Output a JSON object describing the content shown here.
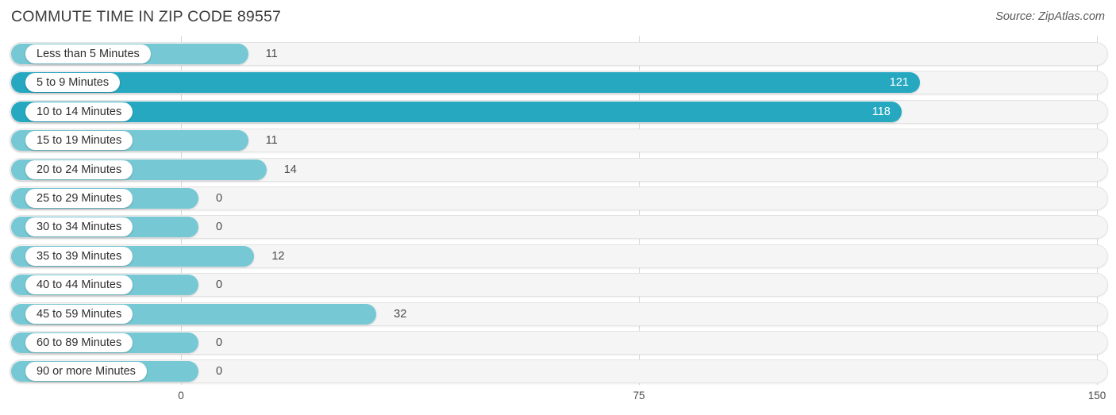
{
  "header": {
    "title": "COMMUTE TIME IN ZIP CODE 89557",
    "source": "Source: ZipAtlas.com"
  },
  "chart_data": {
    "type": "bar",
    "orientation": "horizontal",
    "title": "COMMUTE TIME IN ZIP CODE 89557",
    "xlabel": "",
    "ylabel": "",
    "xlim": [
      0,
      150
    ],
    "ticks": [
      "0",
      "75",
      "150"
    ],
    "tick_values": [
      0,
      75,
      150
    ],
    "grid": true,
    "legend": null,
    "categories": [
      "Less than 5 Minutes",
      "5 to 9 Minutes",
      "10 to 14 Minutes",
      "15 to 19 Minutes",
      "20 to 24 Minutes",
      "25 to 29 Minutes",
      "30 to 34 Minutes",
      "35 to 39 Minutes",
      "40 to 44 Minutes",
      "45 to 59 Minutes",
      "60 to 89 Minutes",
      "90 or more Minutes"
    ],
    "values": [
      11,
      121,
      118,
      11,
      14,
      0,
      0,
      12,
      0,
      32,
      0,
      0
    ],
    "value_labels": [
      "11",
      "121",
      "118",
      "11",
      "14",
      "0",
      "0",
      "12",
      "0",
      "32",
      "0",
      "0"
    ],
    "colors": {
      "bar_light": "#76c8d4",
      "bar_dark": "#26a8c0",
      "track": "#f5f5f5",
      "track_border": "#e3e3e3",
      "gridline": "#d8d8d8",
      "label_pill": "#ffffff",
      "value_text_outside": "#4a4a4a",
      "value_text_inside": "#ffffff"
    }
  }
}
